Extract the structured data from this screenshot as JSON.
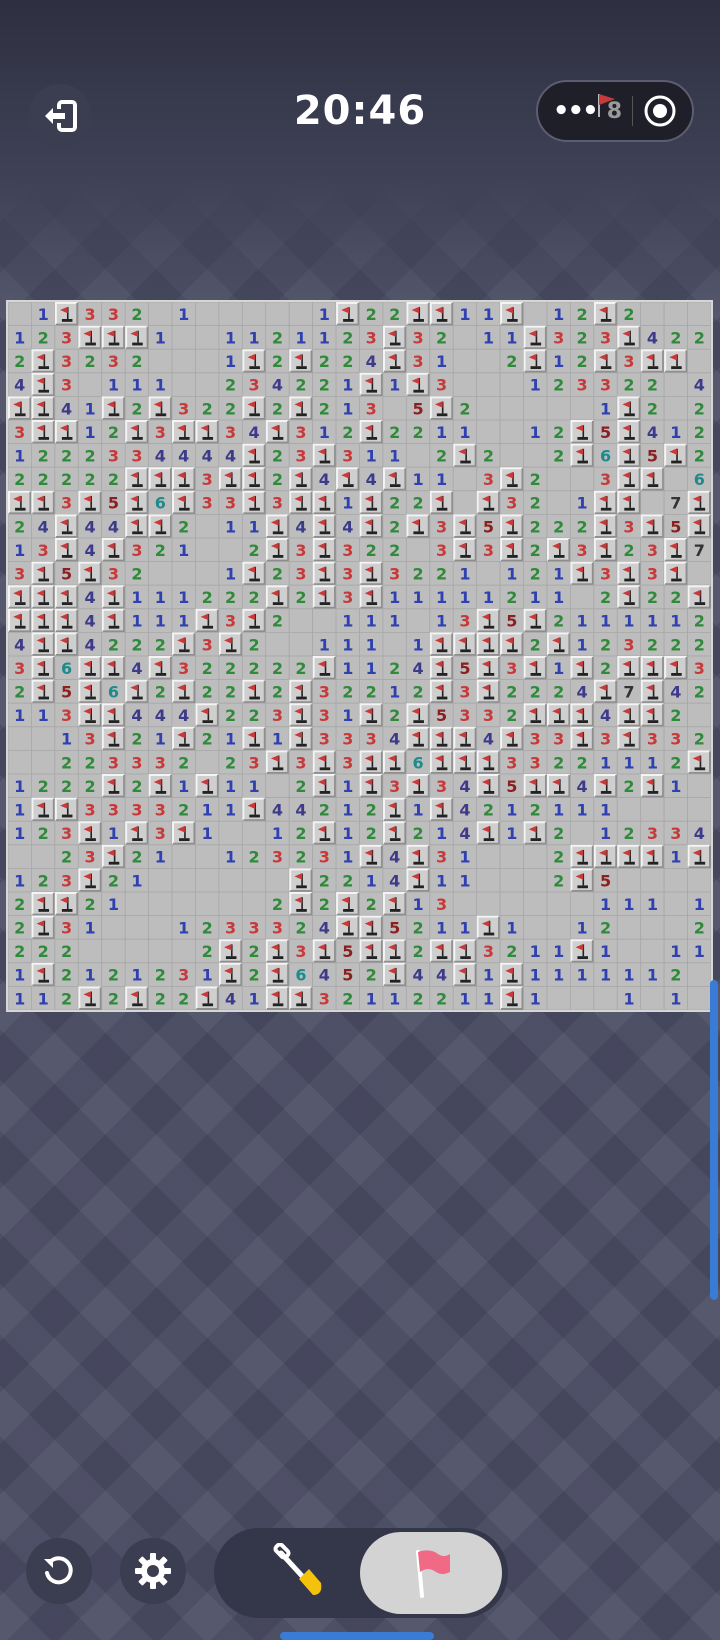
{
  "header": {
    "timer": "20:46",
    "flag_counter": "8",
    "menu_dots": "•••"
  },
  "colors": {
    "num": {
      "1": "#2f40b0",
      "2": "#2f8a3a",
      "3": "#c83a3a",
      "4": "#3d3a8a",
      "5": "#8a2020",
      "6": "#1f8a8a",
      "7": "#333333",
      "8": "#777777"
    },
    "flag_red": "#c83a3a",
    "accent_blue": "#3a7bd5",
    "flag_button_pink": "#f06a86"
  },
  "board": {
    "columns": 30,
    "rows": 30,
    "legend": "digits 1-8 = revealed count, '.' = revealed empty, 'F' = flagged, '#' = covered",
    "grid": [
      ".1F332.1.....1F22FF11F.12F2...",
      "123FFF1..1121123F32.11F323F422",
      "2F3232...1F2F224F31..2F12F3FF",
      "4F3.111..234221F1F3...123322.4F",
      "FF41F2F322F2F213.5F2.....1F2.2F",
      "3FF12F3FF34F312F2211..12F5F412",
      "1222334444F23F311.2F2..2F6F5F2",
      "22222FFF3FF2F4F4F11.3F2..3FF.6F3",
      "FF3F5F6F33F3FF1F22F.F32.1FF.7F3",
      "24F44FF2.11F4F4F2F3F5F222F3F5FF5F2",
      "13F4F321..2F3F322.3F3F2F3F23F7FFF",
      "3F5F32...1F23F3F3221.121F3F3F.FF.",
      "FFF4F111222F2F3F11111211.2F22F5FF",
      "FFF4F111F3F2..111.13F5F21111122",
      "4FF4222F3F2..111.1FFFF2F1232221",
      "3F6FF4F322222F1124F5F3F1F2FFF3FF1",
      "2F5F6F2F22F2F32212F3F2224F7F423",
      "113FF444F223F31F2F5332FFF4FF2.1F",
      "..13F21F21F1F3334FFF4F33F3F33222",
      "..223332.23F3F3FF6FFF33221112F3F1",
      "1222F2F1F11.2F1F3F34F5FF4F2F1...13F31",
      "1FF3333211F44212F1F4212111.....2F31",
      "123F1F3F1..12F12F214F1F2.1233434F",
      "..23F21..123231F4F31...2FFFF1F3F1",
      "123F21......F2214F11...2F5.....321",
      "2FF21......2F2F2F13......111.12...21",
      "2F31...1233324FF5211F1..12...2F32",
      "222.....2F2F3F5FF2FF3211F1..11F3222F1",
      "1F2121231F2F6452F44F1F1111112.1122",
      "112F2F22F41FF32112211F1...1.1.."
    ]
  },
  "controls": {
    "exit": "exit-icon",
    "restart": "restart-icon",
    "settings": "gear-icon",
    "dig": "shovel-icon",
    "flag": "flag-icon"
  }
}
